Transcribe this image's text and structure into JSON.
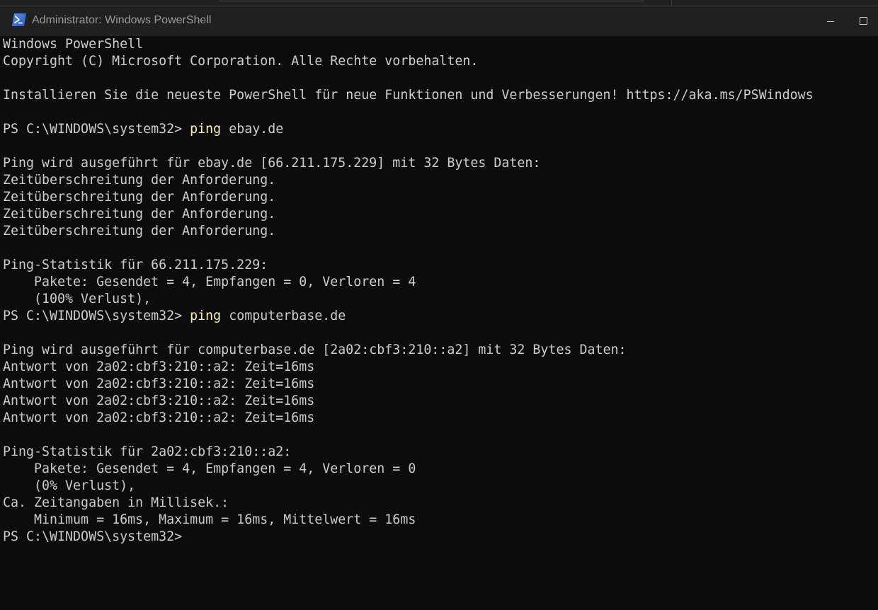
{
  "window": {
    "title": "Administrator: Windows PowerShell",
    "icon": "powershell-icon",
    "controls": [
      "minimize-icon",
      "maximize-icon"
    ]
  },
  "colors": {
    "background": "#0c0c0c",
    "text": "#cccccc",
    "command": "#f9f1a5",
    "titlebar": "#202020"
  },
  "console": {
    "lines": [
      {
        "text": "Windows PowerShell"
      },
      {
        "text": "Copyright (C) Microsoft Corporation. Alle Rechte vorbehalten."
      },
      {
        "text": ""
      },
      {
        "text": "Installieren Sie die neueste PowerShell für neue Funktionen und Verbesserungen! https://aka.ms/PSWindows"
      },
      {
        "text": ""
      },
      {
        "prompt": "PS C:\\WINDOWS\\system32> ",
        "command": "ping",
        "args": " ebay.de"
      },
      {
        "text": ""
      },
      {
        "text": "Ping wird ausgeführt für ebay.de [66.211.175.229] mit 32 Bytes Daten:"
      },
      {
        "text": "Zeitüberschreitung der Anforderung."
      },
      {
        "text": "Zeitüberschreitung der Anforderung."
      },
      {
        "text": "Zeitüberschreitung der Anforderung."
      },
      {
        "text": "Zeitüberschreitung der Anforderung."
      },
      {
        "text": ""
      },
      {
        "text": "Ping-Statistik für 66.211.175.229:"
      },
      {
        "text": "    Pakete: Gesendet = 4, Empfangen = 0, Verloren = 4"
      },
      {
        "text": "    (100% Verlust),"
      },
      {
        "prompt": "PS C:\\WINDOWS\\system32> ",
        "command": "ping",
        "args": " computerbase.de"
      },
      {
        "text": ""
      },
      {
        "text": "Ping wird ausgeführt für computerbase.de [2a02:cbf3:210::a2] mit 32 Bytes Daten:"
      },
      {
        "text": "Antwort von 2a02:cbf3:210::a2: Zeit=16ms"
      },
      {
        "text": "Antwort von 2a02:cbf3:210::a2: Zeit=16ms"
      },
      {
        "text": "Antwort von 2a02:cbf3:210::a2: Zeit=16ms"
      },
      {
        "text": "Antwort von 2a02:cbf3:210::a2: Zeit=16ms"
      },
      {
        "text": ""
      },
      {
        "text": "Ping-Statistik für 2a02:cbf3:210::a2:"
      },
      {
        "text": "    Pakete: Gesendet = 4, Empfangen = 4, Verloren = 0"
      },
      {
        "text": "    (0% Verlust),"
      },
      {
        "text": "Ca. Zeitangaben in Millisek.:"
      },
      {
        "text": "    Minimum = 16ms, Maximum = 16ms, Mittelwert = 16ms"
      },
      {
        "prompt": "PS C:\\WINDOWS\\system32>"
      }
    ]
  }
}
